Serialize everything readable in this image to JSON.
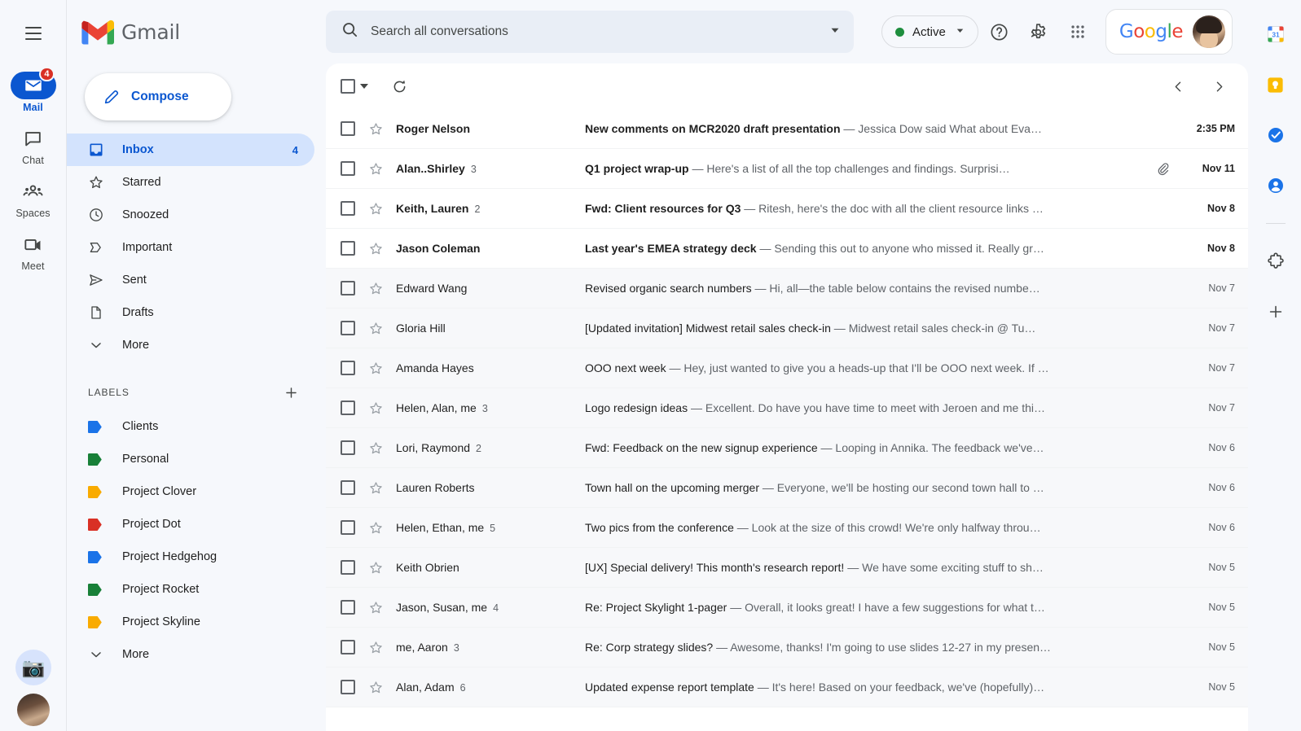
{
  "brand": {
    "name": "Gmail"
  },
  "rail": {
    "menu_icon": "hamburger-icon",
    "items": [
      {
        "label": "Mail",
        "icon": "mail-icon",
        "active": true,
        "badge": "4"
      },
      {
        "label": "Chat",
        "icon": "chat-bubble-icon",
        "active": false,
        "badge": ""
      },
      {
        "label": "Spaces",
        "icon": "spaces-people-icon",
        "active": false,
        "badge": ""
      },
      {
        "label": "Meet",
        "icon": "video-camera-icon",
        "active": false,
        "badge": ""
      }
    ],
    "bottom": {
      "emoji_avatar": "📷",
      "profile_avatar": "user-photo"
    }
  },
  "sidebar": {
    "compose": {
      "label": "Compose",
      "icon": "pencil-icon"
    },
    "nav": [
      {
        "label": "Inbox",
        "icon": "inbox-icon",
        "count": "4",
        "selected": true
      },
      {
        "label": "Starred",
        "icon": "star-outline-icon",
        "count": "",
        "selected": false
      },
      {
        "label": "Snoozed",
        "icon": "clock-icon",
        "count": "",
        "selected": false
      },
      {
        "label": "Important",
        "icon": "important-marker-icon",
        "count": "",
        "selected": false
      },
      {
        "label": "Sent",
        "icon": "send-paperplane-icon",
        "count": "",
        "selected": false
      },
      {
        "label": "Drafts",
        "icon": "document-icon",
        "count": "",
        "selected": false
      },
      {
        "label": "More",
        "icon": "chevron-down-icon",
        "count": "",
        "selected": false
      }
    ],
    "labels_header": {
      "title": "LABELS",
      "add_icon": "plus-icon"
    },
    "labels": [
      {
        "label": "Clients",
        "color": "#1a73e8"
      },
      {
        "label": "Personal",
        "color": "#188038"
      },
      {
        "label": "Project Clover",
        "color": "#f9ab00"
      },
      {
        "label": "Project Dot",
        "color": "#d93025"
      },
      {
        "label": "Project Hedgehog",
        "color": "#1a73e8"
      },
      {
        "label": "Project Rocket",
        "color": "#188038"
      },
      {
        "label": "Project Skyline",
        "color": "#f9ab00"
      }
    ],
    "labels_more": {
      "label": "More",
      "icon": "chevron-down-icon"
    }
  },
  "search": {
    "placeholder": "Search all conversations",
    "value": "",
    "search_icon": "search-icon",
    "options_icon": "chevron-down-icon"
  },
  "topbar": {
    "status": {
      "label": "Active",
      "dot_color": "#1e8e3e",
      "caret_icon": "chevron-down-icon"
    },
    "help_icon": "help-circle-icon",
    "settings_icon": "gear-icon",
    "apps_icon": "apps-grid-icon",
    "google_logo": "Google",
    "avatar": "account-avatar"
  },
  "list_toolbar": {
    "select_all_icon": "checkbox-icon",
    "select_caret_icon": "chevron-down-icon",
    "refresh_icon": "refresh-icon",
    "prev_icon": "chevron-left-icon",
    "next_icon": "chevron-right-icon"
  },
  "emails": [
    {
      "sender": "Roger Nelson",
      "count": "",
      "subject": "New comments on MCR2020 draft presentation",
      "snippet": "Jessica Dow said What about Eva…",
      "date": "2:35 PM",
      "unread": true,
      "attachment": false
    },
    {
      "sender": "Alan..Shirley",
      "count": "3",
      "subject": "Q1 project wrap-up",
      "snippet": "Here's a list of all the top challenges and findings. Surprisi…",
      "date": "Nov 11",
      "unread": true,
      "attachment": true
    },
    {
      "sender": "Keith, Lauren",
      "count": "2",
      "subject": "Fwd: Client resources for Q3",
      "snippet": "Ritesh, here's the doc with all the client resource links …",
      "date": "Nov 8",
      "unread": true,
      "attachment": false
    },
    {
      "sender": "Jason Coleman",
      "count": "",
      "subject": "Last year's EMEA strategy deck",
      "snippet": "Sending this out to anyone who missed it. Really gr…",
      "date": "Nov 8",
      "unread": true,
      "attachment": false
    },
    {
      "sender": "Edward Wang",
      "count": "",
      "subject": "Revised organic search numbers",
      "snippet": "Hi, all—the table below contains the revised numbe…",
      "date": "Nov 7",
      "unread": false,
      "attachment": false
    },
    {
      "sender": "Gloria Hill",
      "count": "",
      "subject": "[Updated invitation] Midwest retail sales check-in",
      "snippet": "Midwest retail sales check-in @ Tu…",
      "date": "Nov 7",
      "unread": false,
      "attachment": false
    },
    {
      "sender": "Amanda Hayes",
      "count": "",
      "subject": "OOO next week",
      "snippet": "Hey, just wanted to give you a heads-up that I'll be OOO next week. If …",
      "date": "Nov 7",
      "unread": false,
      "attachment": false
    },
    {
      "sender": "Helen, Alan, me",
      "count": "3",
      "subject": "Logo redesign ideas",
      "snippet": "Excellent. Do have you have time to meet with Jeroen and me thi…",
      "date": "Nov 7",
      "unread": false,
      "attachment": false
    },
    {
      "sender": "Lori, Raymond",
      "count": "2",
      "subject": "Fwd: Feedback on the new signup experience",
      "snippet": "Looping in Annika. The feedback we've…",
      "date": "Nov 6",
      "unread": false,
      "attachment": false
    },
    {
      "sender": "Lauren Roberts",
      "count": "",
      "subject": "Town hall on the upcoming merger",
      "snippet": "Everyone, we'll be hosting our second town hall to …",
      "date": "Nov 6",
      "unread": false,
      "attachment": false
    },
    {
      "sender": "Helen, Ethan, me",
      "count": "5",
      "subject": "Two pics from the conference",
      "snippet": "Look at the size of this crowd! We're only halfway throu…",
      "date": "Nov 6",
      "unread": false,
      "attachment": false
    },
    {
      "sender": "Keith Obrien",
      "count": "",
      "subject": "[UX] Special delivery! This month's research report!",
      "snippet": "We have some exciting stuff to sh…",
      "date": "Nov 5",
      "unread": false,
      "attachment": false
    },
    {
      "sender": "Jason, Susan, me",
      "count": "4",
      "subject": "Re: Project Skylight 1-pager",
      "snippet": "Overall, it looks great! I have a few suggestions for what t…",
      "date": "Nov 5",
      "unread": false,
      "attachment": false
    },
    {
      "sender": "me, Aaron",
      "count": "3",
      "subject": "Re: Corp strategy slides?",
      "snippet": "Awesome, thanks! I'm going to use slides 12-27 in my presen…",
      "date": "Nov 5",
      "unread": false,
      "attachment": false
    },
    {
      "sender": "Alan, Adam",
      "count": "6",
      "subject": "Updated expense report template",
      "snippet": "It's here! Based on your feedback, we've (hopefully)…",
      "date": "Nov 5",
      "unread": false,
      "attachment": false
    }
  ],
  "right_rail": [
    {
      "name": "google-calendar-icon",
      "label": "Calendar"
    },
    {
      "name": "google-keep-icon",
      "label": "Keep"
    },
    {
      "name": "google-tasks-icon",
      "label": "Tasks"
    },
    {
      "name": "google-contacts-icon",
      "label": "Contacts"
    },
    {
      "name": "add-ons-puzzle-icon",
      "label": "Get Add-ons"
    },
    {
      "name": "plus-icon",
      "label": "Add"
    }
  ],
  "separators": {
    "em_dash": "—"
  }
}
